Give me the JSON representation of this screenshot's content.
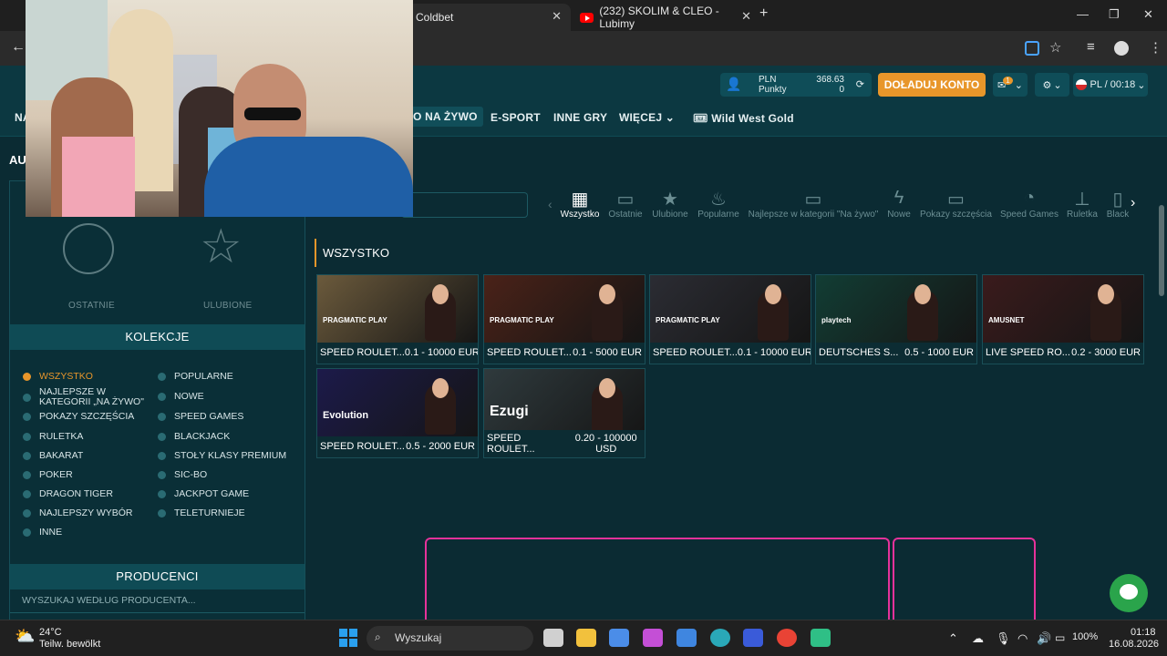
{
  "browser": {
    "tabs": [
      {
        "title": "Coldbet",
        "active": true
      },
      {
        "title": "(232) SKOLIM & CLEO - Lubimy",
        "active": false
      }
    ],
    "new_tab": "+",
    "window_controls": [
      "—",
      "❐",
      "✕"
    ]
  },
  "header": {
    "account": {
      "currency": "PLN",
      "points_label": "Punkty",
      "balance": "368.63",
      "points": "0"
    },
    "topup_label": "DOŁADUJ KONTO",
    "locale": "PL / 00:18",
    "notification_count": "1",
    "menu": [
      {
        "label": "NA"
      },
      {
        "label": "O NA ŻYWO",
        "selected": true
      },
      {
        "label": "E-SPORT"
      },
      {
        "label": "INNE GRY"
      },
      {
        "label": "WIĘCEJ"
      }
    ],
    "promo_label": "Wild West Gold"
  },
  "page": {
    "side_label": "AU"
  },
  "categories": [
    {
      "label": "Wszystko",
      "icon": "grid-icon",
      "active": true
    },
    {
      "label": "Ostatnie",
      "icon": "money-icon"
    },
    {
      "label": "Ulubione",
      "icon": "star-icon"
    },
    {
      "label": "Popularne",
      "icon": "flame-icon"
    },
    {
      "label": "Najlepsze w kategorii \"Na żywo\"",
      "icon": "money-icon"
    },
    {
      "label": "Nowe",
      "icon": "bolt-icon"
    },
    {
      "label": "Pokazy szczęścia",
      "icon": "money-icon"
    },
    {
      "label": "Speed Games",
      "icon": "speedometer-icon"
    },
    {
      "label": "Ruletka",
      "icon": "roulette-icon"
    },
    {
      "label": "Black",
      "icon": "cards-icon"
    }
  ],
  "sidebar": {
    "recent_label": "OSTATNIE",
    "favorites_label": "ULUBIONE",
    "collections_title": "KOLEKCJE",
    "collections_left": [
      "WSZYSTKO",
      "NAJLEPSZE W KATEGORII „NA ŻYWO\"",
      "POKAZY SZCZĘŚCIA",
      "RULETKA",
      "BAKARAT",
      "POKER",
      "DRAGON TIGER",
      "NAJLEPSZY WYBÓR",
      "INNE"
    ],
    "collections_right": [
      "POPULARNE",
      "NOWE",
      "SPEED GAMES",
      "BLACKJACK",
      "STOŁY KLASY PREMIUM",
      "SIC-BO",
      "JACKPOT GAME",
      "TELETURNIEJE"
    ],
    "producers_title": "PRODUCENCI",
    "producers_placeholder": "WYSZUKAJ WEDŁUG PRODUCENTA..."
  },
  "games": {
    "section_title": "WSZYSTKO",
    "cards": [
      {
        "name": "SPEED ROULET...",
        "limits": "0.1 - 10000 EUR",
        "brand": "PRAGMATIC PLAY",
        "bg": "#6b5a3c"
      },
      {
        "name": "SPEED ROULET...",
        "limits": "0.1 - 5000 EUR",
        "brand": "PRAGMATIC PLAY",
        "bg": "#4a2218"
      },
      {
        "name": "SPEED ROULET...",
        "limits": "0.1 - 10000 EUR",
        "brand": "PRAGMATIC PLAY",
        "bg": "#2b2c33"
      },
      {
        "name": "DEUTSCHES S...",
        "limits": "0.5 - 1000 EUR",
        "brand": "playtech",
        "bg": "#123d34"
      },
      {
        "name": "LIVE SPEED RO...",
        "limits": "0.2 - 3000 EUR",
        "brand": "AMUSNET",
        "bg": "#3a1b1c"
      },
      {
        "name": "SPEED ROULET...",
        "limits": "0.5 - 2000 EUR",
        "brand": "Evolution",
        "bg": "#1c1a4a"
      },
      {
        "name": "SPEED ROULET...",
        "limits": "0.20 - 100000 USD",
        "brand": "Ezugi",
        "bg": "#2f3a3d"
      }
    ]
  },
  "taskbar": {
    "weather_temp": "24°C",
    "weather_desc": "Teilw. bewölkt",
    "search_placeholder": "Wyszukaj",
    "battery": "100%",
    "time": "01:18",
    "date": "16.08.2026"
  }
}
